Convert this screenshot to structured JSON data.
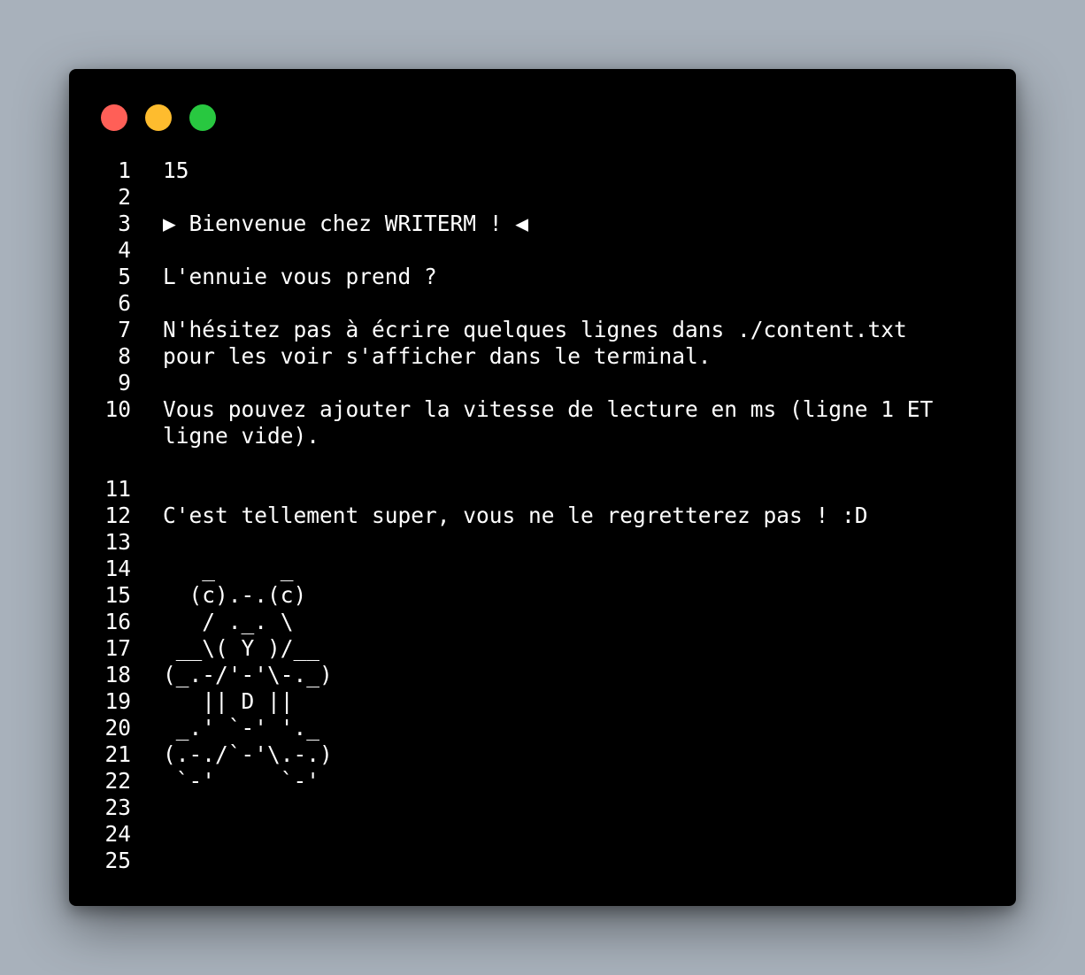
{
  "window": {
    "buttons": {
      "close_color": "#ff5f57",
      "minimize_color": "#febc2e",
      "maximize_color": "#28c840"
    }
  },
  "lines": [
    {
      "n": "1",
      "text": "15"
    },
    {
      "n": "2",
      "text": ""
    },
    {
      "n": "3",
      "text": "▶ Bienvenue chez WRITERM ! ◀"
    },
    {
      "n": "4",
      "text": ""
    },
    {
      "n": "5",
      "text": "L'ennuie vous prend ?"
    },
    {
      "n": "6",
      "text": ""
    },
    {
      "n": "7",
      "text": "N'hésitez pas à écrire quelques lignes dans ./content.txt"
    },
    {
      "n": "8",
      "text": "pour les voir s'afficher dans le terminal."
    },
    {
      "n": "9",
      "text": ""
    },
    {
      "n": "10",
      "text": "Vous pouvez ajouter la vitesse de lecture en ms (ligne 1 ET ligne vide)."
    },
    {
      "n": "",
      "text": ""
    },
    {
      "n": "11",
      "text": ""
    },
    {
      "n": "12",
      "text": "C'est tellement super, vous ne le regretterez pas ! :D"
    },
    {
      "n": "13",
      "text": ""
    },
    {
      "n": "14",
      "text": "   _     _"
    },
    {
      "n": "15",
      "text": "  (c).-.(c)"
    },
    {
      "n": "16",
      "text": "   / ._. \\"
    },
    {
      "n": "17",
      "text": " __\\( Y )/__"
    },
    {
      "n": "18",
      "text": "(_.-/'-'\\-._)"
    },
    {
      "n": "19",
      "text": "   || D ||"
    },
    {
      "n": "20",
      "text": " _.' `-' '._"
    },
    {
      "n": "21",
      "text": "(.-./`-'\\.-.)"
    },
    {
      "n": "22",
      "text": " `-'     `-'"
    },
    {
      "n": "23",
      "text": ""
    },
    {
      "n": "24",
      "text": ""
    },
    {
      "n": "25",
      "text": ""
    }
  ]
}
